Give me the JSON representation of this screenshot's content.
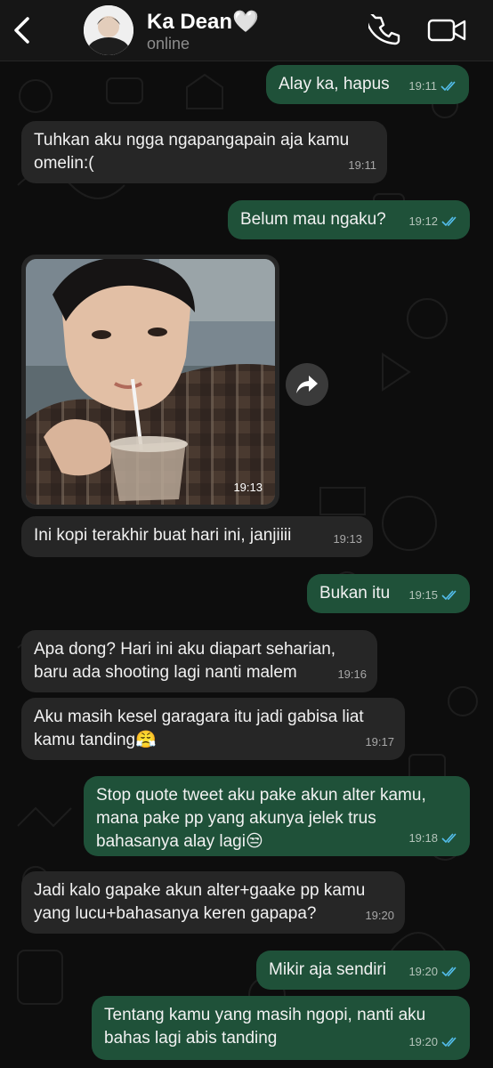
{
  "header": {
    "contact_name": "Ka Dean",
    "name_emoji": "🤍",
    "status": "online",
    "icons": [
      "back-chevron-icon",
      "phone-icon",
      "video-camera-icon"
    ]
  },
  "colors": {
    "incoming_bubble": "#262626",
    "outgoing_bubble": "#1f5139",
    "read_ticks": "#53bdeb",
    "header_bg": "#161616"
  },
  "messages": [
    {
      "direction": "out",
      "text": "Alay ka, hapus",
      "time": "19:11",
      "read": true
    },
    {
      "direction": "in",
      "text": "Tuhkan aku ngga ngapangapain aja kamu\nomelin:(",
      "time": "19:11"
    },
    {
      "direction": "out",
      "text": "Belum mau ngaku?",
      "time": "19:12",
      "read": true
    },
    {
      "direction": "in",
      "type": "photo",
      "time": "19:13"
    },
    {
      "direction": "in",
      "text": "Ini kopi terakhir buat hari ini, janjiiii",
      "time": "19:13"
    },
    {
      "direction": "out",
      "text": "Bukan itu",
      "time": "19:15",
      "read": true
    },
    {
      "direction": "in",
      "text": "Apa dong? Hari ini aku diapart seharian,\nbaru ada shooting lagi nanti malem",
      "time": "19:16"
    },
    {
      "direction": "in",
      "text": "Aku masih kesel garagara itu jadi gabisa liat\nkamu tanding😤",
      "time": "19:17"
    },
    {
      "direction": "out",
      "text": "Stop quote tweet aku pake akun alter kamu,\nmana pake pp yang akunya jelek trus\nbahasanya alay lagi😒",
      "time": "19:18",
      "read": true
    },
    {
      "direction": "in",
      "text": "Jadi kalo gapake akun alter+gaake pp kamu\nyang lucu+bahasanya keren gapapa?",
      "time": "19:20"
    },
    {
      "direction": "out",
      "text": "Mikir aja sendiri",
      "time": "19:20",
      "read": true
    },
    {
      "direction": "out",
      "text": "Tentang kamu yang masih ngopi, nanti aku\nbahas lagi abis tanding",
      "time": "19:20",
      "read": true
    }
  ]
}
